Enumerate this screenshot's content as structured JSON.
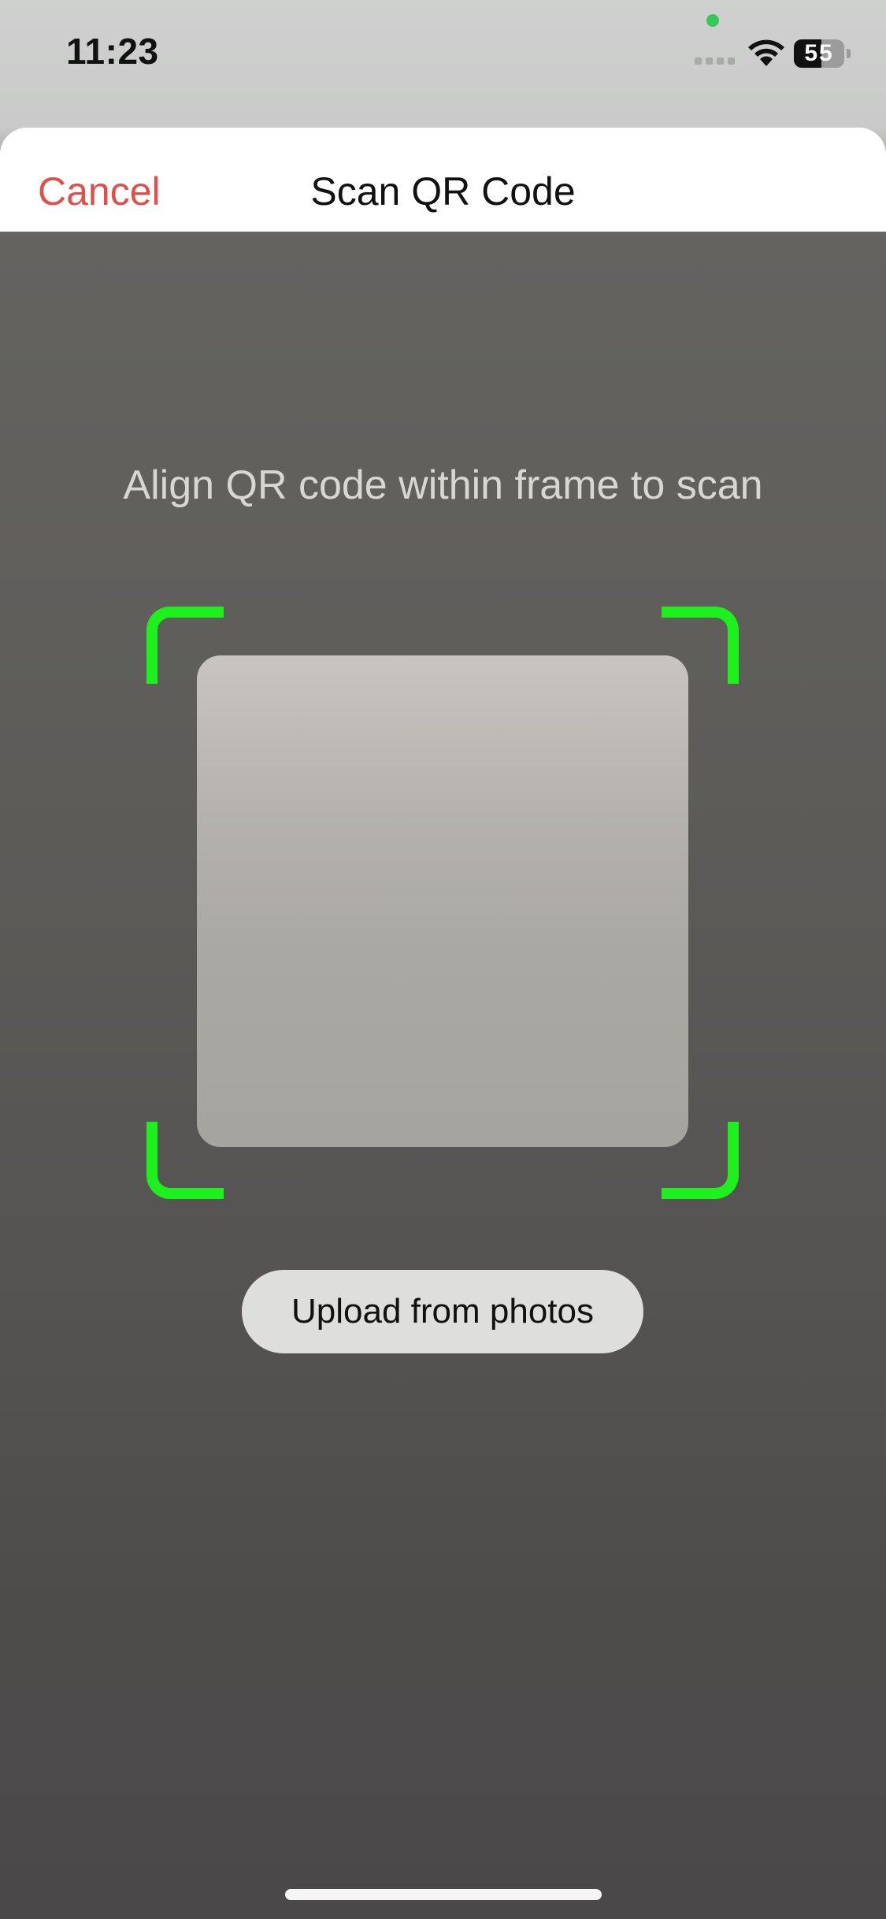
{
  "status_bar": {
    "time": "11:23",
    "battery_level": "55",
    "battery_fraction": 0.55,
    "privacy_indicator_color": "#34c759",
    "icons": [
      "signal-icon",
      "wifi-icon",
      "battery-icon"
    ]
  },
  "header": {
    "cancel_label": "Cancel",
    "title": "Scan QR Code",
    "cancel_color": "#e0504b"
  },
  "scanner": {
    "instruction": "Align QR code within frame to scan",
    "frame_color": "#1df01d"
  },
  "actions": {
    "upload_label": "Upload from photos"
  }
}
